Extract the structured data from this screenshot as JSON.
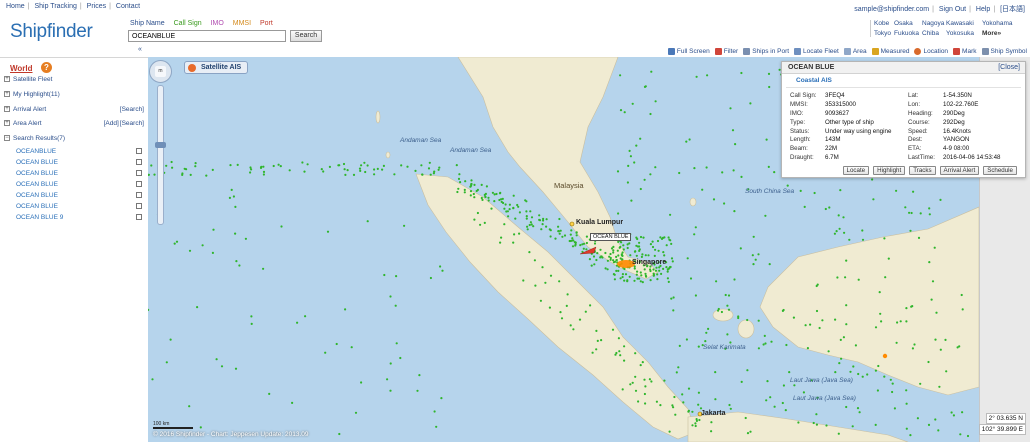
{
  "topnav": [
    "Home",
    "Ship Tracking",
    "Prices",
    "Contact"
  ],
  "logo": "Shipfinder",
  "search_types": [
    {
      "label": "Ship Name",
      "color": "#2a4d8a"
    },
    {
      "label": "Call Sign",
      "color": "#3a9a1e"
    },
    {
      "label": "IMO",
      "color": "#b04bb0"
    },
    {
      "label": "MMSI",
      "color": "#d48a1c"
    },
    {
      "label": "Port",
      "color": "#c0392b"
    }
  ],
  "search": {
    "value": "OCEANBLUE",
    "button": "Search"
  },
  "account": {
    "email": "sample@shipfinder.com",
    "sign_out": "Sign Out",
    "help": "Help",
    "lang": "[日本語]"
  },
  "ports": [
    "Kobe",
    "Osaka",
    "Nagoya",
    "Kawasaki",
    "Yokohama",
    "Tokyo",
    "Fukuoka",
    "Chiba",
    "Yokosuka",
    "More»"
  ],
  "collapse_arrow": "«",
  "toolbar": [
    {
      "label": "Full Screen",
      "icon": "fullscreen-icon",
      "color": "#4a78b8"
    },
    {
      "label": "Filter",
      "icon": "filter-icon",
      "color": "#d0453a"
    },
    {
      "label": "Ships in Port",
      "icon": "port-icon",
      "color": "#7a8fb0"
    },
    {
      "label": "Locate Fleet",
      "icon": "locate-fleet-icon",
      "color": "#6e8fbf"
    },
    {
      "label": "Area",
      "icon": "area-icon",
      "color": "#8fa7c8"
    },
    {
      "label": "Measured",
      "icon": "ruler-icon",
      "color": "#d9a520"
    },
    {
      "label": "Location",
      "icon": "location-icon",
      "color": "#d86a2c"
    },
    {
      "label": "Mark",
      "icon": "mark-icon",
      "color": "#d0453a"
    },
    {
      "label": "Ship Symbol",
      "icon": "ship-symbol-icon",
      "color": "#7d90ad"
    }
  ],
  "sidebar": {
    "world": "World",
    "world_badge": "?",
    "rows": [
      {
        "label": "Satellite Fleet",
        "sign": "+",
        "right": []
      },
      {
        "label": "My Highlight(11)",
        "sign": "+",
        "right": []
      },
      {
        "label": "Arrival Alert",
        "sign": "+",
        "right": [
          "[Search]"
        ]
      },
      {
        "label": "Area Alert",
        "sign": "+",
        "right": [
          "[Add]",
          "[Search]"
        ]
      },
      {
        "label": "Search Results(7)",
        "sign": "−",
        "right": []
      }
    ],
    "results": [
      "OCEANBLUE",
      "OCEAN BLUE",
      "OCEAN BLUE",
      "OCEAN BLUE",
      "OCEAN BLUE",
      "OCEAN BLUE",
      "OCEAN BLUE 9"
    ]
  },
  "map": {
    "satellite_button": "Satellite AIS",
    "nav_label": "m",
    "labels": [
      {
        "text": "Andaman Sea",
        "kind": "sea"
      },
      {
        "text": "Andaman Sea",
        "kind": "sea"
      },
      {
        "text": "Malaysia",
        "kind": "land"
      },
      {
        "text": "South China Sea",
        "kind": "sea"
      },
      {
        "text": "Kuala Lumpur",
        "kind": "city"
      },
      {
        "text": "Singapore",
        "kind": "city"
      },
      {
        "text": "Laut Jawa (Java Sea)",
        "kind": "sea"
      },
      {
        "text": "Jakarta",
        "kind": "city"
      },
      {
        "text": "Selat Karimata",
        "kind": "sea"
      },
      {
        "text": "Laut Jawa (Java Sea)",
        "kind": "sea"
      }
    ],
    "ship_tag": "OCEAN BLUE",
    "scale": "100 km",
    "copyright": "© 2016 Shipfinder - Chart: Jeppesen Update: 2013.09",
    "coords": [
      "2° 03.635 N",
      "102° 39.899 E"
    ],
    "colors": {
      "water": "#b6d4ec",
      "land": "#f0ebd2",
      "ship": "#2fb52c",
      "highlight": "#ff8a00"
    }
  },
  "panel": {
    "title": "OCEAN BLUE",
    "close": "[Close]",
    "sub": "Coastal AIS",
    "rows": [
      [
        "Call Sign:",
        "3FEQ4",
        "Lat:",
        "1-54.350N"
      ],
      [
        "MMSI:",
        "353315000",
        "Lon:",
        "102-22.760E"
      ],
      [
        "IMO:",
        "9093627",
        "Heading:",
        "290Deg"
      ],
      [
        "Type:",
        "Other type of ship",
        "Course:",
        "292Deg"
      ],
      [
        "Status:",
        "Under way using engine",
        "Speed:",
        "16.4Knots"
      ],
      [
        "Length:",
        "143M",
        "Dest:",
        "YANGON"
      ],
      [
        "Beam:",
        "22M",
        "ETA:",
        "4-9 08:00"
      ],
      [
        "Draught:",
        "6.7M",
        "LastTime:",
        "2016-04-06 14:53:48"
      ]
    ],
    "buttons": [
      "Locate",
      "Highlight",
      "Tracks",
      "Arrival Alert",
      "Schedule"
    ]
  }
}
